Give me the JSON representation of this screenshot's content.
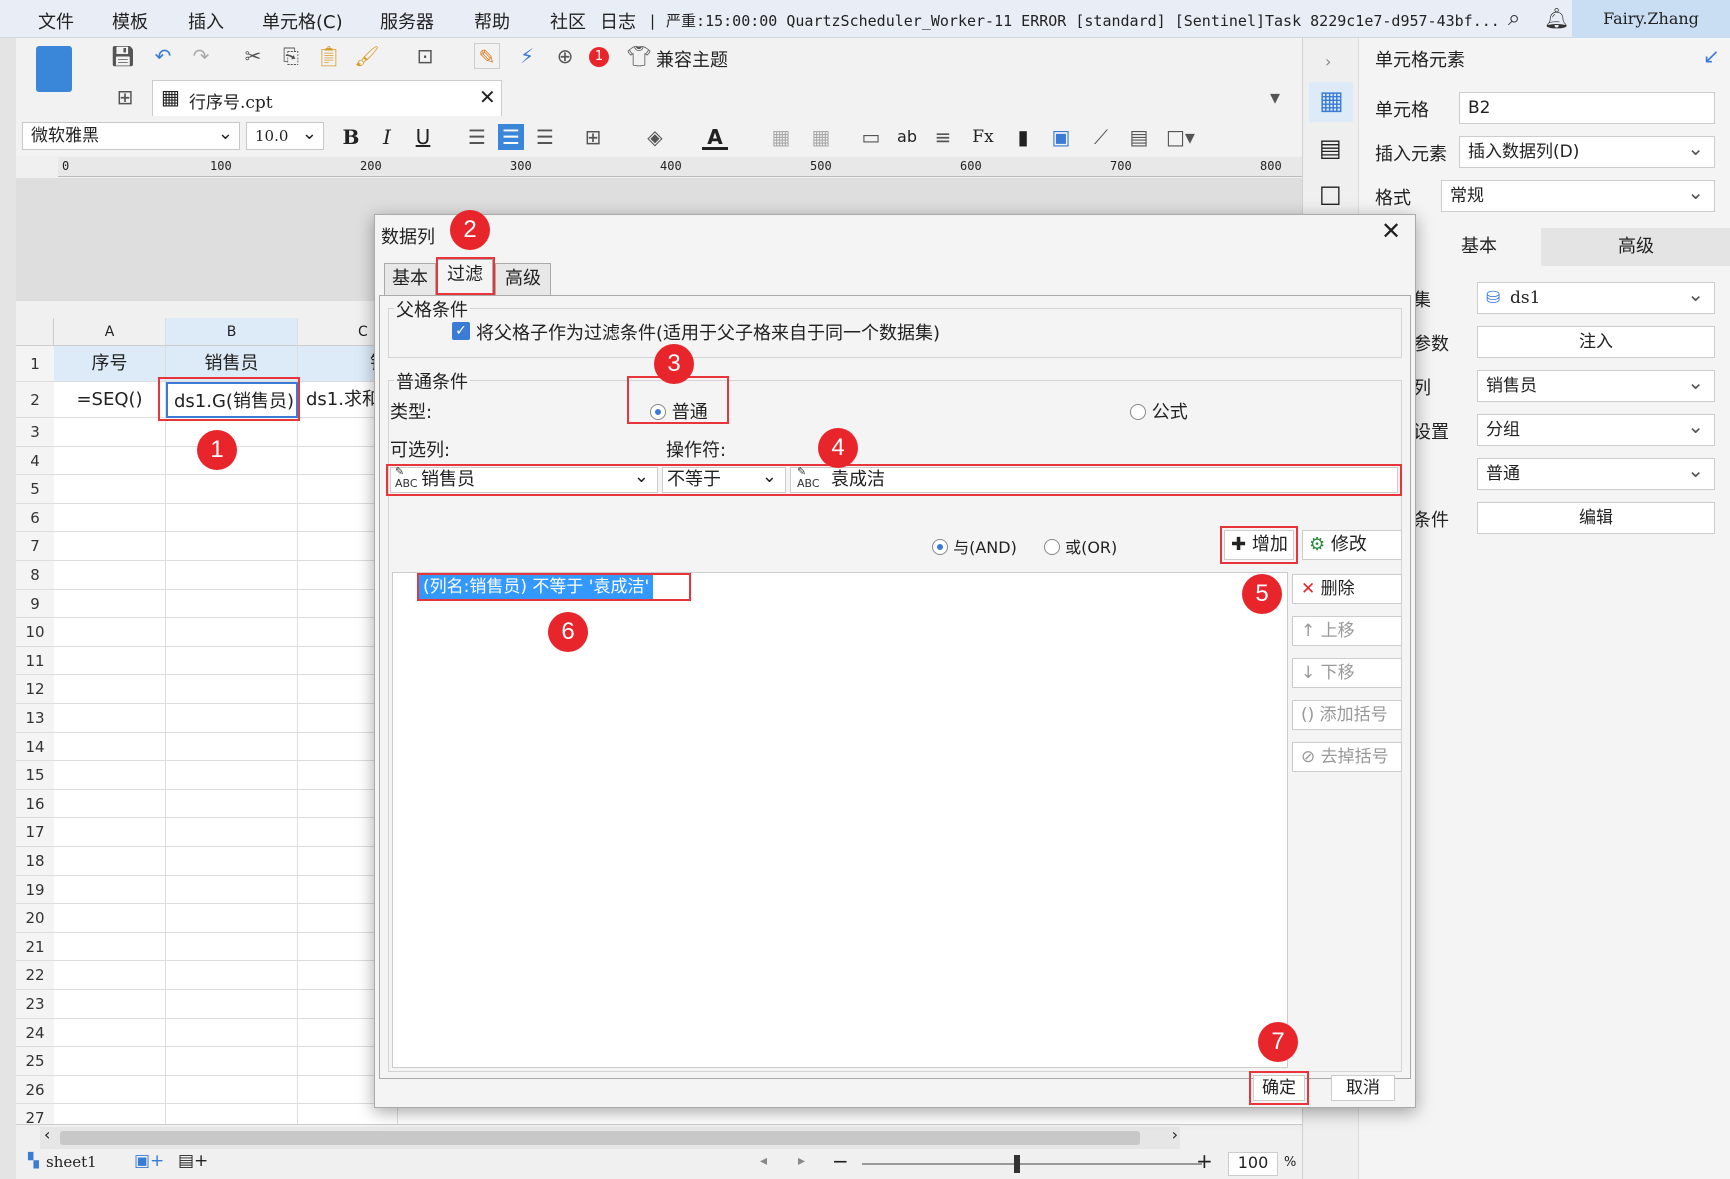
{
  "menu": {
    "items": [
      "文件",
      "模板",
      "插入",
      "单元格(C)",
      "服务器",
      "帮助",
      "社区",
      "日志"
    ],
    "log_text": "| 严重:15:00:00 QuartzScheduler_Worker-11 ERROR [standard] [Sentinel]Task 8229c1e7-d957-43bf...",
    "user": "Fairy.Zhang"
  },
  "toolbar": {
    "compat_theme": "兼容主题",
    "notify_count": "1",
    "file_tab": "行序号.cpt",
    "font_name": "微软雅黑",
    "font_size": "10.0"
  },
  "ruler": {
    "marks": [
      "0",
      "100",
      "200",
      "300",
      "400",
      "500",
      "600",
      "700",
      "800"
    ]
  },
  "sheet": {
    "columns": [
      "A",
      "B",
      "C"
    ],
    "row1": {
      "a": "序号",
      "b": "销售员",
      "c": "销"
    },
    "row2": {
      "a": "=SEQ()",
      "b": "ds1.G(销售员)",
      "c": "ds1.求和"
    },
    "row_numbers": [
      "1",
      "2",
      "3",
      "4",
      "5",
      "6",
      "7",
      "8",
      "9",
      "10",
      "11",
      "12",
      "13",
      "14",
      "15",
      "16",
      "17",
      "18",
      "19",
      "20",
      "21",
      "22",
      "23",
      "24",
      "25",
      "26",
      "27"
    ]
  },
  "bottombar": {
    "sheet_name": "sheet1",
    "zoom": "100",
    "zoom_unit": "%",
    "minus": "−",
    "plus": "+"
  },
  "rightpanel": {
    "title": "单元格元素",
    "cell_label": "单元格",
    "cell_value": "B2",
    "insert_label": "插入元素",
    "insert_value": "插入数据列(D)",
    "format_label": "格式",
    "format_value": "常规",
    "tab_basic": "基本",
    "tab_advanced": "高级",
    "ds_label": "集",
    "ds_value": "ds1",
    "param_label": "参数",
    "param_btn": "注入",
    "col_label": "列",
    "col_value": "销售员",
    "setting_label": "设置",
    "setting_value": "分组",
    "setting2_value": "普通",
    "cond_label": "条件",
    "cond_btn": "编辑"
  },
  "dialog": {
    "title": "数据列",
    "tabs": [
      "基本",
      "过滤",
      "高级"
    ],
    "parent_group": "父格条件",
    "parent_checkbox": "将父格子作为过滤条件(适用于父子格来自于同一个数据集)",
    "normal_group": "普通条件",
    "type_label": "类型:",
    "type_normal": "普通",
    "type_formula": "公式",
    "col_label": "可选列:",
    "op_label": "操作符:",
    "col_value": "销售员",
    "op_value": "不等于",
    "value_text": "袁成洁",
    "and_label": "与(AND)",
    "or_label": "或(OR)",
    "add_btn": "增加",
    "modify_btn": "修改",
    "delete_btn": "删除",
    "up_btn": "上移",
    "down_btn": "下移",
    "add_paren_btn": "添加括号",
    "remove_paren_btn": "去掉括号",
    "condition_item": "(列名:销售员) 不等于 '袁成洁'",
    "ok_btn": "确定",
    "cancel_btn": "取消"
  },
  "badges": [
    "1",
    "2",
    "3",
    "4",
    "5",
    "6",
    "7"
  ],
  "colors": {
    "accent": "#3a7bd5",
    "highlight_red": "#e8353c",
    "badge_red": "#e8252b",
    "selection": "#3399ff"
  }
}
